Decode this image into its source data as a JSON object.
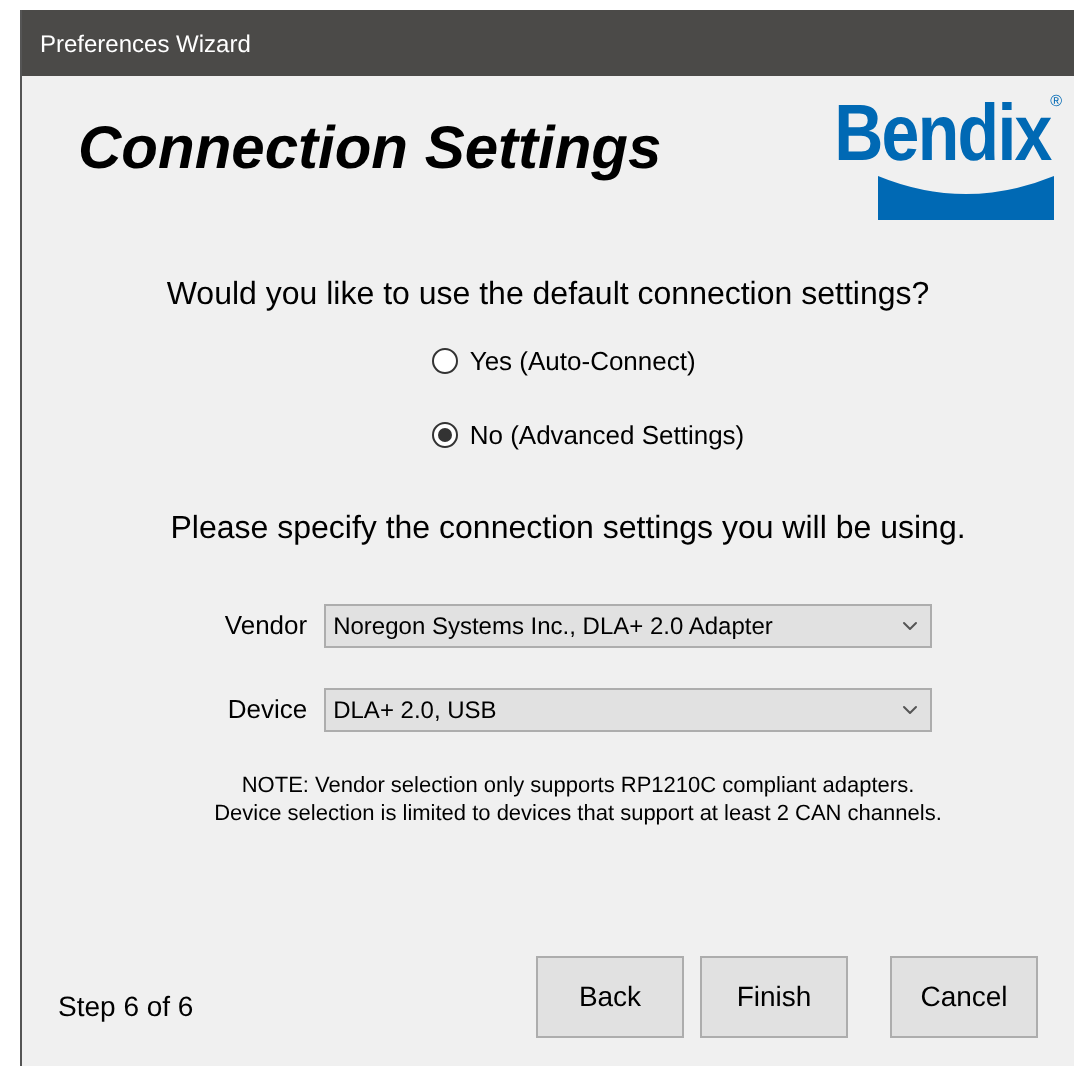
{
  "window": {
    "title": "Preferences Wizard"
  },
  "header": {
    "title": "Connection Settings",
    "logo": {
      "text": "Bendix",
      "mark": "®"
    }
  },
  "question": "Would you like to use the default connection settings?",
  "options": [
    {
      "label": "Yes (Auto-Connect)",
      "selected": false
    },
    {
      "label": "No (Advanced Settings)",
      "selected": true
    }
  ],
  "instruction": "Please specify the connection settings you will be using.",
  "fields": [
    {
      "label": "Vendor",
      "value": "Noregon Systems Inc., DLA+ 2.0 Adapter"
    },
    {
      "label": "Device",
      "value": "DLA+ 2.0, USB"
    }
  ],
  "note": [
    "NOTE: Vendor selection only supports RP1210C compliant adapters.",
    "Device selection is limited to devices that support at least 2 CAN channels."
  ],
  "footer": {
    "step": "Step 6 of 6",
    "buttons": [
      "Back",
      "Finish",
      "Cancel"
    ]
  }
}
